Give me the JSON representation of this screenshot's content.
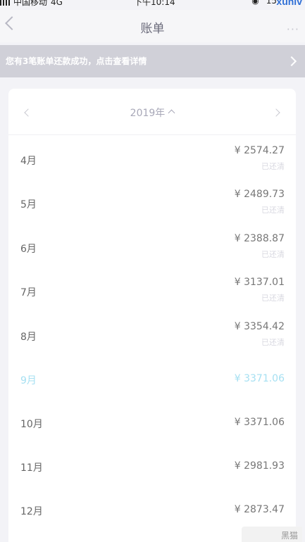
{
  "status_bar": {
    "carrier": "中国移动",
    "network": "4G",
    "time": "下午10:14",
    "right": "15",
    "watermark": "xunlv"
  },
  "nav": {
    "title": "账单",
    "more": "···"
  },
  "notice": {
    "text": "您有3笔账单还款成功，点击查看详情"
  },
  "year_selector": {
    "label": "2019年"
  },
  "bills": [
    {
      "month": "4月",
      "amount": "¥ 2574.27",
      "status": "已还清"
    },
    {
      "month": "5月",
      "amount": "¥ 2489.73",
      "status": "已还清"
    },
    {
      "month": "6月",
      "amount": "¥ 2388.87",
      "status": "已还清"
    },
    {
      "month": "7月",
      "amount": "¥ 3137.01",
      "status": "已还清"
    },
    {
      "month": "8月",
      "amount": "¥ 3354.42",
      "status": "已还清"
    },
    {
      "month": "9月",
      "amount": "¥ 3371.06",
      "status": ""
    },
    {
      "month": "10月",
      "amount": "¥ 3371.06",
      "status": ""
    },
    {
      "month": "11月",
      "amount": "¥ 2981.93",
      "status": ""
    },
    {
      "month": "12月",
      "amount": "¥ 2873.47",
      "status": ""
    }
  ],
  "corner_mark": {
    "text": "黑猫"
  },
  "colors": {
    "current_month": "#a6e0f2",
    "background": "#f3f3f7",
    "notice_bg": "#d0d0d8"
  }
}
